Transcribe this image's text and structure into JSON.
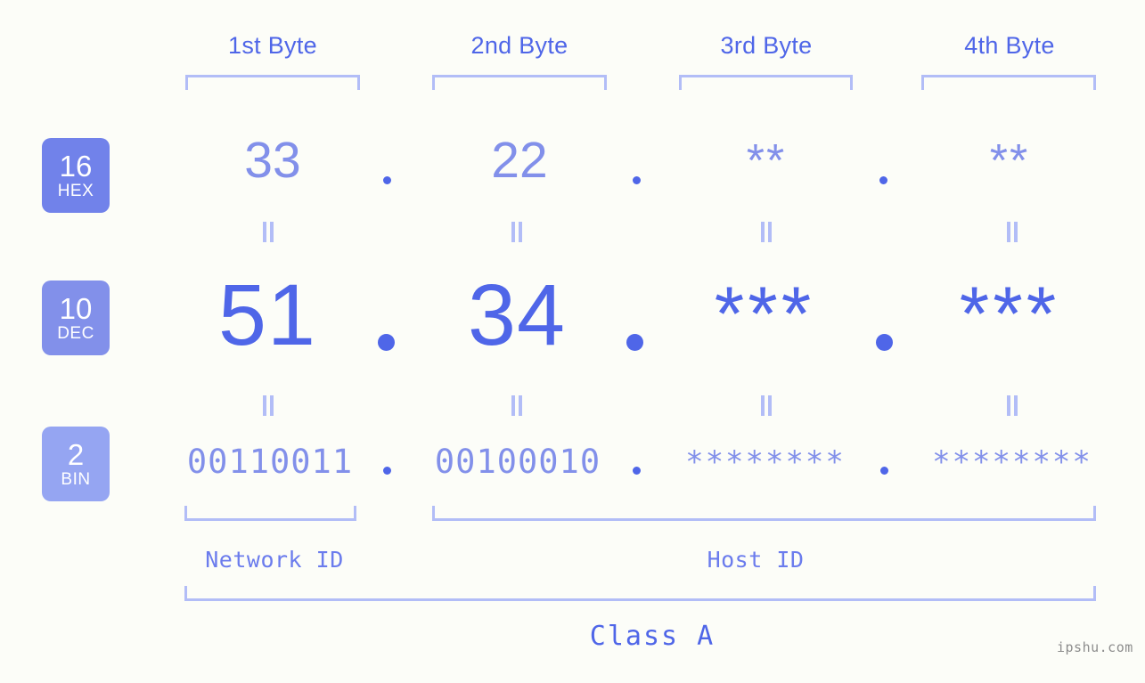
{
  "background_color": "#fcfdf8",
  "accent_strong": "#4f66e8",
  "accent_light": "#8290ea",
  "accent_pale": "#b2bdf7",
  "byte_headers": [
    {
      "label": "1st Byte"
    },
    {
      "label": "2nd Byte"
    },
    {
      "label": "3rd Byte"
    },
    {
      "label": "4th Byte"
    }
  ],
  "rows": {
    "hex": {
      "badge_number": "16",
      "badge_name": "HEX",
      "badge_color": "#7182ea",
      "values": [
        "33",
        "22",
        "**",
        "**"
      ],
      "separator": "."
    },
    "dec": {
      "badge_number": "10",
      "badge_name": "DEC",
      "badge_color": "#8290ea",
      "values": [
        "51",
        "34",
        "***",
        "***"
      ],
      "separator": "."
    },
    "bin": {
      "badge_number": "2",
      "badge_name": "BIN",
      "badge_color": "#95a5f2",
      "values": [
        "00110011",
        "00100010",
        "********",
        "********"
      ],
      "separator": "."
    }
  },
  "equality_symbol": "=",
  "segments": {
    "network_id": "Network ID",
    "host_id": "Host ID",
    "class": "Class A"
  },
  "watermark": "ipshu.com"
}
